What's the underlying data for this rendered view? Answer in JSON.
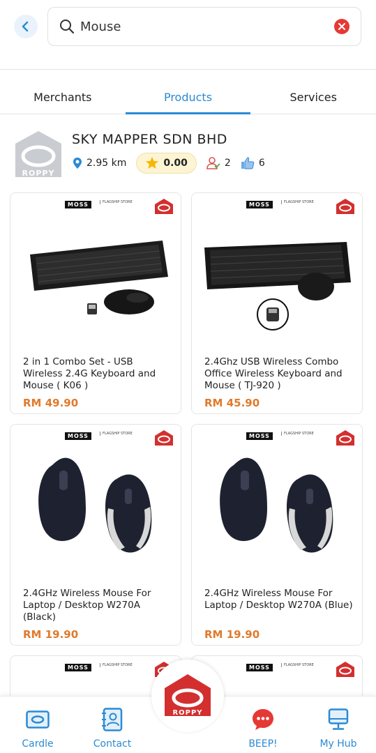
{
  "search": {
    "query": "Mouse"
  },
  "tabs": [
    {
      "label": "Merchants"
    },
    {
      "label": "Products"
    },
    {
      "label": "Services"
    }
  ],
  "merchant": {
    "name": "SKY MAPPER SDN BHD",
    "logo_text": "ROPPY",
    "distance": "2.95 km",
    "rating": "0.00",
    "followers": "2",
    "likes": "6"
  },
  "brand": {
    "moss": "MOSS",
    "store": "FLAGSHIP STORE",
    "roppy": "ROPPY"
  },
  "products": [
    {
      "title": "2 in 1 Combo Set - USB Wireless 2.4G Keyboard and Mouse ( K06 )",
      "price": "RM 49.90"
    },
    {
      "title": "2.4Ghz USB Wireless Combo Office Wireless Keyboard and Mouse ( TJ-920 )",
      "price": "RM 45.90"
    },
    {
      "title": "2.4GHz Wireless Mouse For Laptop / Desktop W270A (Black)",
      "price": "RM 19.90"
    },
    {
      "title": "2.4GHz Wireless Mouse For Laptop / Desktop W270A (Blue)",
      "price": "RM 19.90"
    }
  ],
  "bottom_nav": [
    {
      "label": "Cardle",
      "icon": "card-icon"
    },
    {
      "label": "Contact",
      "icon": "contact-icon"
    },
    {
      "label": "BEEP!",
      "icon": "chat-icon"
    },
    {
      "label": "My Hub",
      "icon": "monitor-icon"
    }
  ],
  "colors": {
    "accent": "#2a8ad4",
    "price": "#e07a2c",
    "brand_red": "#d32f2f"
  }
}
